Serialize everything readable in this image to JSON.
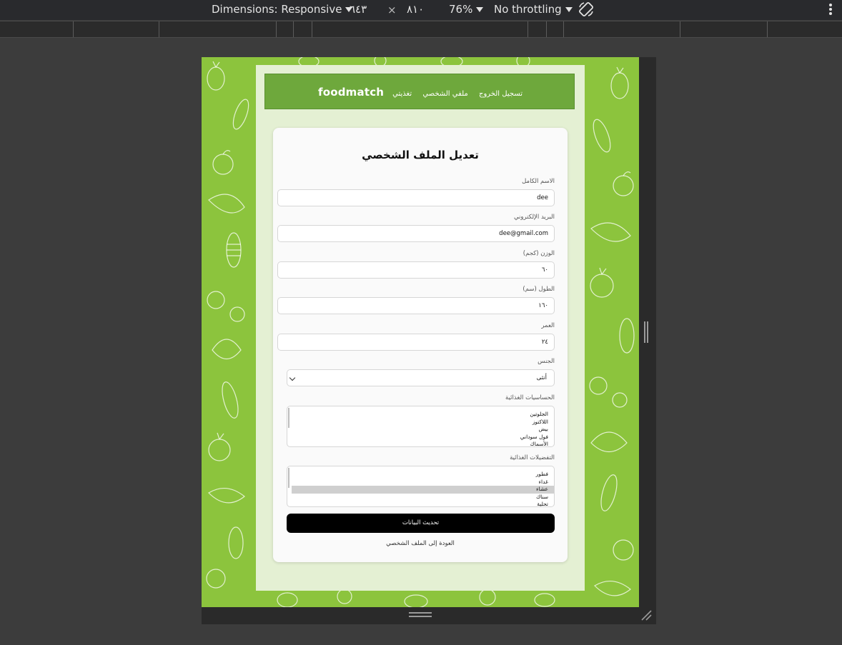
{
  "devtools": {
    "dimensions_label": "Dimensions: Responsive",
    "width_value": "٦٤٣",
    "times": "×",
    "height_value": "٨١٠",
    "zoom": "76%",
    "throttling": "No throttling",
    "icons": [
      "caret-down-icon",
      "rotate-icon",
      "more-vert-icon"
    ]
  },
  "navbar": {
    "brand": "foodmatch",
    "links": [
      "تسجيل الخروج",
      "ملفي الشخصي",
      "تغذيتي"
    ]
  },
  "form": {
    "title": "تعديل الملف الشخصي",
    "fields": [
      {
        "label": "الاسم الكامل",
        "value": "dee"
      },
      {
        "label": "البريد الإلكتروني",
        "value": "dee@gmail.com"
      },
      {
        "label": "الوزن (كجم)",
        "value": "٦٠"
      },
      {
        "label": "الطول (سم)",
        "value": "١٦٠"
      },
      {
        "label": "العمر",
        "value": "٢٤"
      }
    ],
    "gender": {
      "label": "الجنس",
      "selected": "أنثى"
    },
    "allergies": {
      "label": "الحساسيات الغذائية",
      "options": [
        "الجلوتين",
        "اللاكتوز",
        "بيض",
        "فول سوداني",
        "الأسماك"
      ]
    },
    "preferences": {
      "label": "التفضيلات الغذائية",
      "options": [
        "فطور",
        "غداء",
        "عشاء",
        "سناك",
        "تحلية"
      ],
      "selected_index": 2
    },
    "submit_label": "تحديث البيانات",
    "back_link": "العودة إلى الملف الشخصي"
  },
  "colors": {
    "background_green": "#8cc43d",
    "navbar_green": "#6ea83c",
    "container": "#e4f0d3",
    "button": "#000000"
  }
}
